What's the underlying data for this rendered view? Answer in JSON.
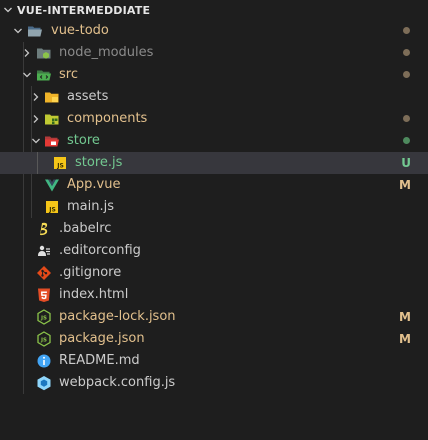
{
  "explorer": {
    "title": "VUE-INTERMEDDIATE",
    "rows": [
      {
        "name": "vue-todo",
        "kind": "folder-open",
        "status": "dot-modified"
      },
      {
        "name": "node_modules",
        "kind": "folder",
        "status": "dot-modified"
      },
      {
        "name": "src",
        "kind": "folder-open",
        "status": "dot-modified"
      },
      {
        "name": "assets",
        "kind": "folder"
      },
      {
        "name": "components",
        "kind": "folder",
        "status": "dot-modified"
      },
      {
        "name": "store",
        "kind": "folder-open",
        "status": "dot-untracked"
      },
      {
        "name": "store.js",
        "kind": "file-js",
        "badge": "U",
        "selected": true
      },
      {
        "name": "App.vue",
        "kind": "file-vue",
        "badge": "M"
      },
      {
        "name": "main.js",
        "kind": "file-js"
      },
      {
        "name": ".babelrc",
        "kind": "file-babel"
      },
      {
        "name": ".editorconfig",
        "kind": "file-editorconfig"
      },
      {
        "name": ".gitignore",
        "kind": "file-git"
      },
      {
        "name": "index.html",
        "kind": "file-html"
      },
      {
        "name": "package-lock.json",
        "kind": "file-npm",
        "badge": "M"
      },
      {
        "name": "package.json",
        "kind": "file-npm",
        "badge": "M"
      },
      {
        "name": "README.md",
        "kind": "file-info"
      },
      {
        "name": "webpack.config.js",
        "kind": "file-webpack"
      }
    ]
  },
  "colors": {
    "background": "#1e1e1e",
    "selected_row": "#37373d",
    "modified": "#e2c08d",
    "untracked": "#73c991",
    "ignored": "#8b8b8b"
  }
}
